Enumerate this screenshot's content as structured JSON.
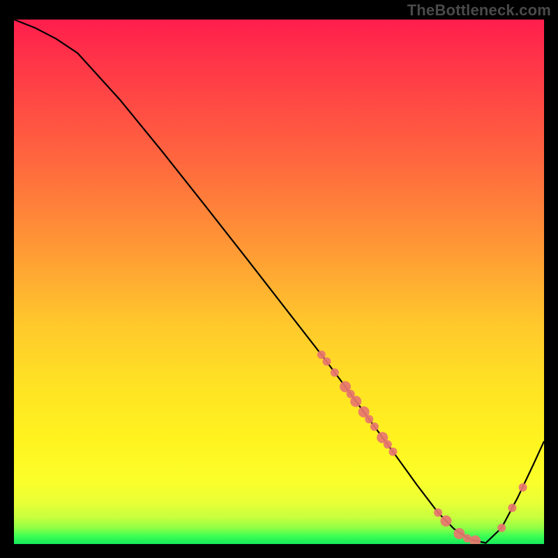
{
  "watermark": "TheBottleneck.com",
  "chart_data": {
    "type": "line",
    "title": "",
    "xlabel": "",
    "ylabel": "",
    "xlim": [
      0,
      100
    ],
    "ylim": [
      0,
      100
    ],
    "series": [
      {
        "name": "curve",
        "x": [
          0,
          4,
          8,
          12,
          20,
          28,
          36,
          44,
          52,
          58,
          62,
          67,
          72,
          76,
          80,
          83,
          86,
          89,
          92,
          95,
          98,
          100
        ],
        "y": [
          100,
          98.4,
          96.3,
          93.6,
          84.7,
          74.8,
          64.6,
          54.3,
          43.9,
          36.1,
          30.7,
          23.8,
          16.9,
          11.3,
          6.0,
          2.9,
          0.9,
          0.2,
          3.1,
          8.8,
          15.2,
          19.6
        ]
      }
    ],
    "points": [
      {
        "x": 58.0,
        "y": 36.1,
        "r": 6
      },
      {
        "x": 59.0,
        "y": 34.8,
        "r": 6
      },
      {
        "x": 60.5,
        "y": 32.7,
        "r": 6
      },
      {
        "x": 62.5,
        "y": 30.0,
        "r": 8
      },
      {
        "x": 63.5,
        "y": 28.6,
        "r": 6
      },
      {
        "x": 64.5,
        "y": 27.2,
        "r": 8
      },
      {
        "x": 66.0,
        "y": 25.2,
        "r": 8
      },
      {
        "x": 67.0,
        "y": 23.8,
        "r": 6
      },
      {
        "x": 68.0,
        "y": 22.4,
        "r": 6
      },
      {
        "x": 69.5,
        "y": 20.3,
        "r": 8
      },
      {
        "x": 70.5,
        "y": 19.0,
        "r": 6
      },
      {
        "x": 71.5,
        "y": 17.6,
        "r": 6
      },
      {
        "x": 80.0,
        "y": 6.0,
        "r": 6
      },
      {
        "x": 81.5,
        "y": 4.4,
        "r": 8
      },
      {
        "x": 84.0,
        "y": 2.0,
        "r": 8
      },
      {
        "x": 85.5,
        "y": 1.1,
        "r": 6
      },
      {
        "x": 87.0,
        "y": 0.6,
        "r": 8
      },
      {
        "x": 92.0,
        "y": 3.1,
        "r": 6
      },
      {
        "x": 94.0,
        "y": 6.9,
        "r": 6
      },
      {
        "x": 96.0,
        "y": 10.8,
        "r": 6
      }
    ],
    "colors": {
      "curve": "#000000",
      "points": "#e8766f",
      "bg_top": "#ff1e4c",
      "bg_bottom": "#14e85a"
    }
  }
}
